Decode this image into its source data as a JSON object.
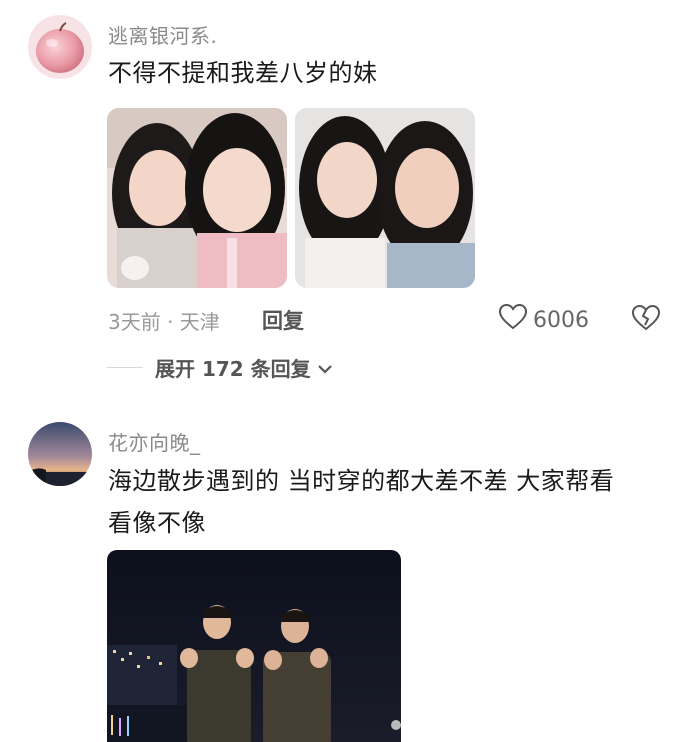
{
  "comments": [
    {
      "username": "逃离银河系.",
      "text": "不得不提和我差八岁的妹",
      "time_location": "3天前 · 天津",
      "reply_label": "回复",
      "likes": "6006",
      "expand_label": "展开 172 条回复"
    },
    {
      "username": "花亦向晚_",
      "text_line1": "海边散步遇到的 当时穿的都大差不差 大家帮看",
      "text_line2": "看像不像"
    }
  ],
  "icons": {
    "like": "heart-icon",
    "dislike": "broken-heart-icon",
    "expand": "chevron-down-icon"
  },
  "colors": {
    "username": "#8a8a8a",
    "meta": "#999999",
    "text": "#1a1a1a"
  }
}
